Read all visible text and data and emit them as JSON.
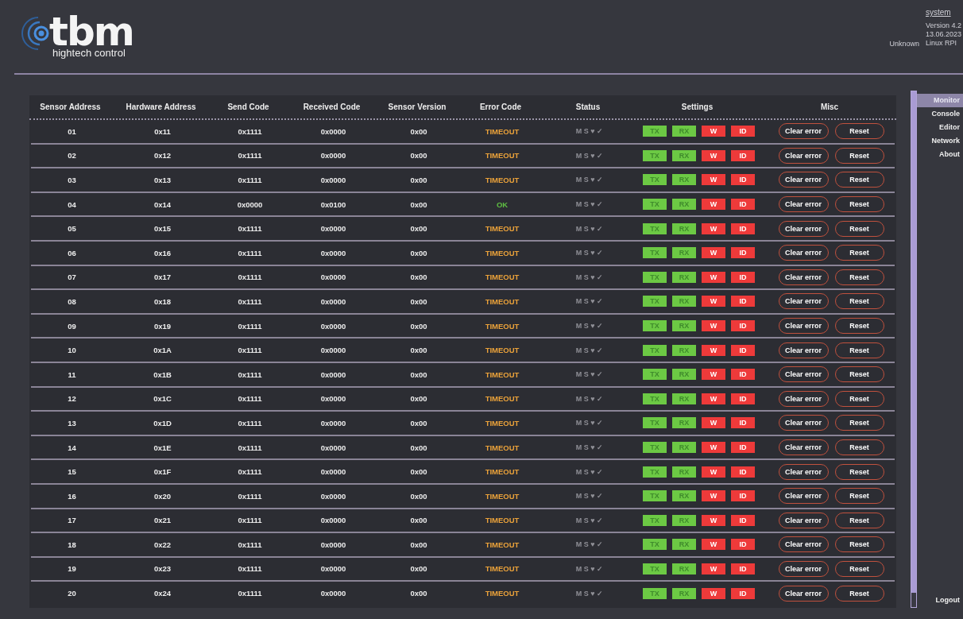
{
  "header": {
    "logo_name": "tbm",
    "logo_tagline": "hightech control",
    "system_link": "system",
    "device_state": "Unknown",
    "info_lines": [
      "Version 4.2",
      "13.06.2023",
      "Linux RPI"
    ]
  },
  "table": {
    "columns": [
      "Sensor Address",
      "Hardware Address",
      "Send Code",
      "Received Code",
      "Sensor Version",
      "Error Code",
      "Status",
      "Settings",
      "Misc"
    ],
    "rows": [
      {
        "cells": [
          "01",
          "0x11",
          "0x1111",
          "0x0000",
          "0x00"
        ],
        "error": {
          "text": "TIMEOUT",
          "color": "#eba23a"
        },
        "status": "M S ♥ ✓",
        "settings": [
          {
            "label": "TX",
            "on": true
          },
          {
            "label": "RX",
            "on": true
          },
          {
            "label": "W",
            "on": false
          },
          {
            "label": "ID",
            "on": false
          }
        ],
        "misc": [
          "Clear error",
          "Reset"
        ]
      },
      {
        "cells": [
          "02",
          "0x12",
          "0x1111",
          "0x0000",
          "0x00"
        ],
        "error": {
          "text": "TIMEOUT",
          "color": "#eba23a"
        },
        "status": "M S ♥ ✓",
        "settings": [
          {
            "label": "TX",
            "on": true
          },
          {
            "label": "RX",
            "on": true
          },
          {
            "label": "W",
            "on": false
          },
          {
            "label": "ID",
            "on": false
          }
        ],
        "misc": [
          "Clear error",
          "Reset"
        ]
      },
      {
        "cells": [
          "03",
          "0x13",
          "0x1111",
          "0x0000",
          "0x00"
        ],
        "error": {
          "text": "TIMEOUT",
          "color": "#eba23a"
        },
        "status": "M S ♥ ✓",
        "settings": [
          {
            "label": "TX",
            "on": true
          },
          {
            "label": "RX",
            "on": true
          },
          {
            "label": "W",
            "on": false
          },
          {
            "label": "ID",
            "on": false
          }
        ],
        "misc": [
          "Clear error",
          "Reset"
        ]
      },
      {
        "cells": [
          "04",
          "0x14",
          "0x0000",
          "0x0100",
          "0x00"
        ],
        "error": {
          "text": "OK",
          "color": "#5fc043"
        },
        "status": "M S ♥ ✓",
        "settings": [
          {
            "label": "TX",
            "on": true
          },
          {
            "label": "RX",
            "on": true
          },
          {
            "label": "W",
            "on": false
          },
          {
            "label": "ID",
            "on": false
          }
        ],
        "misc": [
          "Clear error",
          "Reset"
        ]
      },
      {
        "cells": [
          "05",
          "0x15",
          "0x1111",
          "0x0000",
          "0x00"
        ],
        "error": {
          "text": "TIMEOUT",
          "color": "#eba23a"
        },
        "status": "M S ♥ ✓",
        "settings": [
          {
            "label": "TX",
            "on": true
          },
          {
            "label": "RX",
            "on": true
          },
          {
            "label": "W",
            "on": false
          },
          {
            "label": "ID",
            "on": false
          }
        ],
        "misc": [
          "Clear error",
          "Reset"
        ]
      },
      {
        "cells": [
          "06",
          "0x16",
          "0x1111",
          "0x0000",
          "0x00"
        ],
        "error": {
          "text": "TIMEOUT",
          "color": "#eba23a"
        },
        "status": "M S ♥ ✓",
        "settings": [
          {
            "label": "TX",
            "on": true
          },
          {
            "label": "RX",
            "on": true
          },
          {
            "label": "W",
            "on": false
          },
          {
            "label": "ID",
            "on": false
          }
        ],
        "misc": [
          "Clear error",
          "Reset"
        ]
      },
      {
        "cells": [
          "07",
          "0x17",
          "0x1111",
          "0x0000",
          "0x00"
        ],
        "error": {
          "text": "TIMEOUT",
          "color": "#eba23a"
        },
        "status": "M S ♥ ✓",
        "settings": [
          {
            "label": "TX",
            "on": true
          },
          {
            "label": "RX",
            "on": true
          },
          {
            "label": "W",
            "on": false
          },
          {
            "label": "ID",
            "on": false
          }
        ],
        "misc": [
          "Clear error",
          "Reset"
        ]
      },
      {
        "cells": [
          "08",
          "0x18",
          "0x1111",
          "0x0000",
          "0x00"
        ],
        "error": {
          "text": "TIMEOUT",
          "color": "#eba23a"
        },
        "status": "M S ♥ ✓",
        "settings": [
          {
            "label": "TX",
            "on": true
          },
          {
            "label": "RX",
            "on": true
          },
          {
            "label": "W",
            "on": false
          },
          {
            "label": "ID",
            "on": false
          }
        ],
        "misc": [
          "Clear error",
          "Reset"
        ]
      },
      {
        "cells": [
          "09",
          "0x19",
          "0x1111",
          "0x0000",
          "0x00"
        ],
        "error": {
          "text": "TIMEOUT",
          "color": "#eba23a"
        },
        "status": "M S ♥ ✓",
        "settings": [
          {
            "label": "TX",
            "on": true
          },
          {
            "label": "RX",
            "on": true
          },
          {
            "label": "W",
            "on": false
          },
          {
            "label": "ID",
            "on": false
          }
        ],
        "misc": [
          "Clear error",
          "Reset"
        ]
      },
      {
        "cells": [
          "10",
          "0x1A",
          "0x1111",
          "0x0000",
          "0x00"
        ],
        "error": {
          "text": "TIMEOUT",
          "color": "#eba23a"
        },
        "status": "M S ♥ ✓",
        "settings": [
          {
            "label": "TX",
            "on": true
          },
          {
            "label": "RX",
            "on": true
          },
          {
            "label": "W",
            "on": false
          },
          {
            "label": "ID",
            "on": false
          }
        ],
        "misc": [
          "Clear error",
          "Reset"
        ]
      },
      {
        "cells": [
          "11",
          "0x1B",
          "0x1111",
          "0x0000",
          "0x00"
        ],
        "error": {
          "text": "TIMEOUT",
          "color": "#eba23a"
        },
        "status": "M S ♥ ✓",
        "settings": [
          {
            "label": "TX",
            "on": true
          },
          {
            "label": "RX",
            "on": true
          },
          {
            "label": "W",
            "on": false
          },
          {
            "label": "ID",
            "on": false
          }
        ],
        "misc": [
          "Clear error",
          "Reset"
        ]
      },
      {
        "cells": [
          "12",
          "0x1C",
          "0x1111",
          "0x0000",
          "0x00"
        ],
        "error": {
          "text": "TIMEOUT",
          "color": "#eba23a"
        },
        "status": "M S ♥ ✓",
        "settings": [
          {
            "label": "TX",
            "on": true
          },
          {
            "label": "RX",
            "on": true
          },
          {
            "label": "W",
            "on": false
          },
          {
            "label": "ID",
            "on": false
          }
        ],
        "misc": [
          "Clear error",
          "Reset"
        ]
      },
      {
        "cells": [
          "13",
          "0x1D",
          "0x1111",
          "0x0000",
          "0x00"
        ],
        "error": {
          "text": "TIMEOUT",
          "color": "#eba23a"
        },
        "status": "M S ♥ ✓",
        "settings": [
          {
            "label": "TX",
            "on": true
          },
          {
            "label": "RX",
            "on": true
          },
          {
            "label": "W",
            "on": false
          },
          {
            "label": "ID",
            "on": false
          }
        ],
        "misc": [
          "Clear error",
          "Reset"
        ]
      },
      {
        "cells": [
          "14",
          "0x1E",
          "0x1111",
          "0x0000",
          "0x00"
        ],
        "error": {
          "text": "TIMEOUT",
          "color": "#eba23a"
        },
        "status": "M S ♥ ✓",
        "settings": [
          {
            "label": "TX",
            "on": true
          },
          {
            "label": "RX",
            "on": true
          },
          {
            "label": "W",
            "on": false
          },
          {
            "label": "ID",
            "on": false
          }
        ],
        "misc": [
          "Clear error",
          "Reset"
        ]
      },
      {
        "cells": [
          "15",
          "0x1F",
          "0x1111",
          "0x0000",
          "0x00"
        ],
        "error": {
          "text": "TIMEOUT",
          "color": "#eba23a"
        },
        "status": "M S ♥ ✓",
        "settings": [
          {
            "label": "TX",
            "on": true
          },
          {
            "label": "RX",
            "on": true
          },
          {
            "label": "W",
            "on": false
          },
          {
            "label": "ID",
            "on": false
          }
        ],
        "misc": [
          "Clear error",
          "Reset"
        ]
      },
      {
        "cells": [
          "16",
          "0x20",
          "0x1111",
          "0x0000",
          "0x00"
        ],
        "error": {
          "text": "TIMEOUT",
          "color": "#eba23a"
        },
        "status": "M S ♥ ✓",
        "settings": [
          {
            "label": "TX",
            "on": true
          },
          {
            "label": "RX",
            "on": true
          },
          {
            "label": "W",
            "on": false
          },
          {
            "label": "ID",
            "on": false
          }
        ],
        "misc": [
          "Clear error",
          "Reset"
        ]
      },
      {
        "cells": [
          "17",
          "0x21",
          "0x1111",
          "0x0000",
          "0x00"
        ],
        "error": {
          "text": "TIMEOUT",
          "color": "#eba23a"
        },
        "status": "M S ♥ ✓",
        "settings": [
          {
            "label": "TX",
            "on": true
          },
          {
            "label": "RX",
            "on": true
          },
          {
            "label": "W",
            "on": false
          },
          {
            "label": "ID",
            "on": false
          }
        ],
        "misc": [
          "Clear error",
          "Reset"
        ]
      },
      {
        "cells": [
          "18",
          "0x22",
          "0x1111",
          "0x0000",
          "0x00"
        ],
        "error": {
          "text": "TIMEOUT",
          "color": "#eba23a"
        },
        "status": "M S ♥ ✓",
        "settings": [
          {
            "label": "TX",
            "on": true
          },
          {
            "label": "RX",
            "on": true
          },
          {
            "label": "W",
            "on": false
          },
          {
            "label": "ID",
            "on": false
          }
        ],
        "misc": [
          "Clear error",
          "Reset"
        ]
      },
      {
        "cells": [
          "19",
          "0x23",
          "0x1111",
          "0x0000",
          "0x00"
        ],
        "error": {
          "text": "TIMEOUT",
          "color": "#eba23a"
        },
        "status": "M S ♥ ✓",
        "settings": [
          {
            "label": "TX",
            "on": true
          },
          {
            "label": "RX",
            "on": true
          },
          {
            "label": "W",
            "on": false
          },
          {
            "label": "ID",
            "on": false
          }
        ],
        "misc": [
          "Clear error",
          "Reset"
        ]
      },
      {
        "cells": [
          "20",
          "0x24",
          "0x1111",
          "0x0000",
          "0x00"
        ],
        "error": {
          "text": "TIMEOUT",
          "color": "#eba23a"
        },
        "status": "M S ♥ ✓",
        "settings": [
          {
            "label": "TX",
            "on": true
          },
          {
            "label": "RX",
            "on": true
          },
          {
            "label": "W",
            "on": false
          },
          {
            "label": "ID",
            "on": false
          }
        ],
        "misc": [
          "Clear error",
          "Reset"
        ]
      }
    ]
  },
  "sidebar": {
    "items": [
      {
        "label": "Monitor",
        "selected": true
      },
      {
        "label": "Console",
        "selected": false
      },
      {
        "label": "Editor",
        "selected": false
      },
      {
        "label": "Network",
        "selected": false
      },
      {
        "label": "About",
        "selected": false
      }
    ],
    "logout": "Logout"
  }
}
